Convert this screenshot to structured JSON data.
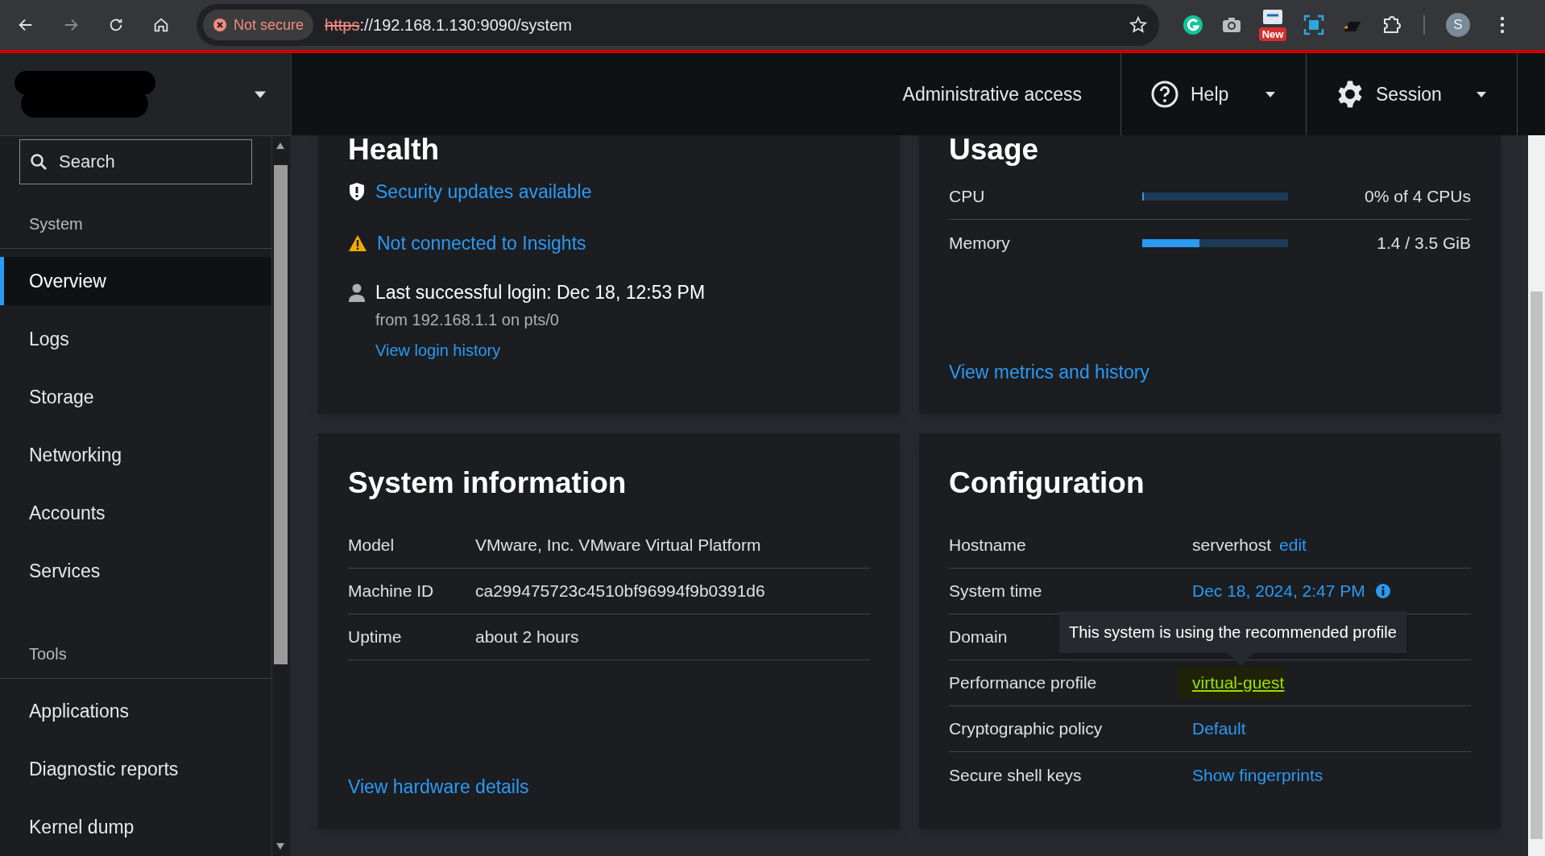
{
  "browser": {
    "security_chip": "Not secure",
    "url_scheme": "https",
    "url_rest": "://192.168.1.130:9090/system",
    "extensions": [
      {
        "kind": "grammarly"
      },
      {
        "kind": "camera"
      },
      {
        "kind": "badge",
        "badge": "New"
      },
      {
        "kind": "capture"
      },
      {
        "kind": "dark"
      },
      {
        "kind": "puzzle"
      }
    ],
    "avatar": "S"
  },
  "header": {
    "admin": "Administrative access",
    "help": "Help",
    "session": "Session"
  },
  "sidebar": {
    "search": {
      "placeholder": "Search"
    },
    "sections": [
      {
        "title": "System",
        "items": [
          {
            "label": "Overview",
            "selected": true
          },
          {
            "label": "Logs",
            "selected": false
          },
          {
            "label": "Storage",
            "selected": false
          },
          {
            "label": "Networking",
            "selected": false
          },
          {
            "label": "Accounts",
            "selected": false
          },
          {
            "label": "Services",
            "selected": false
          }
        ]
      },
      {
        "title": "Tools",
        "items": [
          {
            "label": "Applications",
            "selected": false
          },
          {
            "label": "Diagnostic reports",
            "selected": false
          },
          {
            "label": "Kernel dump",
            "selected": false
          }
        ]
      }
    ]
  },
  "health": {
    "title": "Health",
    "items": [
      {
        "kind": "security",
        "text": "Security updates available"
      },
      {
        "kind": "warning",
        "text": "Not connected to Insights"
      }
    ],
    "login": {
      "title": "Last successful login: Dec 18, 12:53 PM",
      "detail": "from 192.168.1.1 on pts/0",
      "link": "View login history"
    }
  },
  "usage": {
    "title": "Usage",
    "meters": [
      {
        "label": "CPU",
        "level": 0,
        "reading": "0% of 4 CPUs"
      },
      {
        "label": "Memory",
        "level": 0.39,
        "reading": "1.4 / 3.5 GiB"
      }
    ],
    "link": "View metrics and history"
  },
  "system_information": {
    "title": "System information",
    "rows": [
      {
        "label": "Model",
        "value": "VMware, Inc. VMware Virtual Platform"
      },
      {
        "label": "Machine ID",
        "value": "ca299475723c4510bf96994f9b0391d6"
      },
      {
        "label": "Uptime",
        "value": "about 2 hours"
      }
    ],
    "link": "View hardware details"
  },
  "configuration": {
    "title": "Configuration",
    "rows": [
      {
        "label": "Hostname",
        "kind": "text",
        "value": "serverhost",
        "action": "edit"
      },
      {
        "label": "System time",
        "kind": "link_info",
        "value": "Dec 18, 2024, 2:47 PM"
      },
      {
        "label": "Domain",
        "kind": "empty"
      },
      {
        "label": "Performance profile",
        "kind": "link_highlighted",
        "value": "virtual-guest"
      },
      {
        "label": "Cryptographic policy",
        "kind": "link",
        "value": "Default"
      },
      {
        "label": "Secure shell keys",
        "kind": "link",
        "value": "Show fingerprints"
      }
    ],
    "tooltip": "This system is using the recommended profile"
  }
}
